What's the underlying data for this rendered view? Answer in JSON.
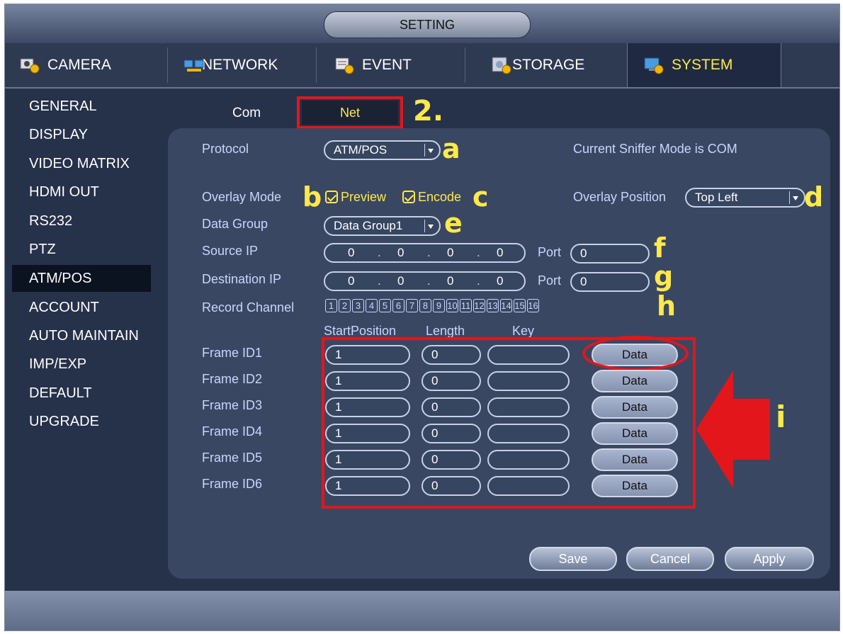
{
  "header": {
    "title": "SETTING"
  },
  "tabs": [
    {
      "label": "CAMERA",
      "icon": "camera-gear-icon"
    },
    {
      "label": "NETWORK",
      "icon": "network-icon"
    },
    {
      "label": "EVENT",
      "icon": "event-gear-icon"
    },
    {
      "label": "STORAGE",
      "icon": "storage-gear-icon"
    },
    {
      "label": "SYSTEM",
      "icon": "system-gear-icon",
      "active": true
    }
  ],
  "sidebar": {
    "items": [
      "GENERAL",
      "DISPLAY",
      "VIDEO MATRIX",
      "HDMI OUT",
      "RS232",
      "PTZ",
      "ATM/POS",
      "ACCOUNT",
      "AUTO MAINTAIN",
      "IMP/EXP",
      "DEFAULT",
      "UPGRADE"
    ],
    "active": "ATM/POS"
  },
  "subtabs": {
    "com": "Com",
    "net": "Net"
  },
  "form": {
    "protocol_label": "Protocol",
    "protocol_value": "ATM/POS",
    "sniffer_status": "Current Sniffer Mode is COM",
    "overlay_mode_label": "Overlay Mode",
    "preview_label": "Preview",
    "encode_label": "Encode",
    "overlay_position_label": "Overlay Position",
    "overlay_position_value": "Top Left",
    "data_group_label": "Data Group",
    "data_group_value": "Data Group1",
    "source_ip_label": "Source IP",
    "source_ip": [
      "0",
      "0",
      "0",
      "0"
    ],
    "source_port_label": "Port",
    "source_port": "0",
    "dest_ip_label": "Destination IP",
    "dest_ip": [
      "0",
      "0",
      "0",
      "0"
    ],
    "dest_port_label": "Port",
    "dest_port": "0",
    "record_channel_label": "Record Channel",
    "channels": [
      "1",
      "2",
      "3",
      "4",
      "5",
      "6",
      "7",
      "8",
      "9",
      "10",
      "11",
      "12",
      "13",
      "14",
      "15",
      "16"
    ]
  },
  "frames": {
    "headers": {
      "start": "StartPosition",
      "length": "Length",
      "key": "Key"
    },
    "rows": [
      {
        "label": "Frame ID1",
        "start": "1",
        "length": "0",
        "key": "",
        "button": "Data"
      },
      {
        "label": "Frame ID2",
        "start": "1",
        "length": "0",
        "key": "",
        "button": "Data"
      },
      {
        "label": "Frame ID3",
        "start": "1",
        "length": "0",
        "key": "",
        "button": "Data"
      },
      {
        "label": "Frame ID4",
        "start": "1",
        "length": "0",
        "key": "",
        "button": "Data"
      },
      {
        "label": "Frame ID5",
        "start": "1",
        "length": "0",
        "key": "",
        "button": "Data"
      },
      {
        "label": "Frame ID6",
        "start": "1",
        "length": "0",
        "key": "",
        "button": "Data"
      }
    ]
  },
  "actions": {
    "save": "Save",
    "cancel": "Cancel",
    "apply": "Apply"
  },
  "annotations": {
    "step": "2.",
    "a": "a",
    "b": "b",
    "c": "c",
    "d": "d",
    "e": "e",
    "f": "f",
    "g": "g",
    "h": "h",
    "i": "i"
  },
  "colors": {
    "annotation_red": "#e3161b",
    "annotation_yellow": "#ffe94a",
    "label_blue": "#c8d6ff",
    "active_tab": "#ffe94a"
  }
}
